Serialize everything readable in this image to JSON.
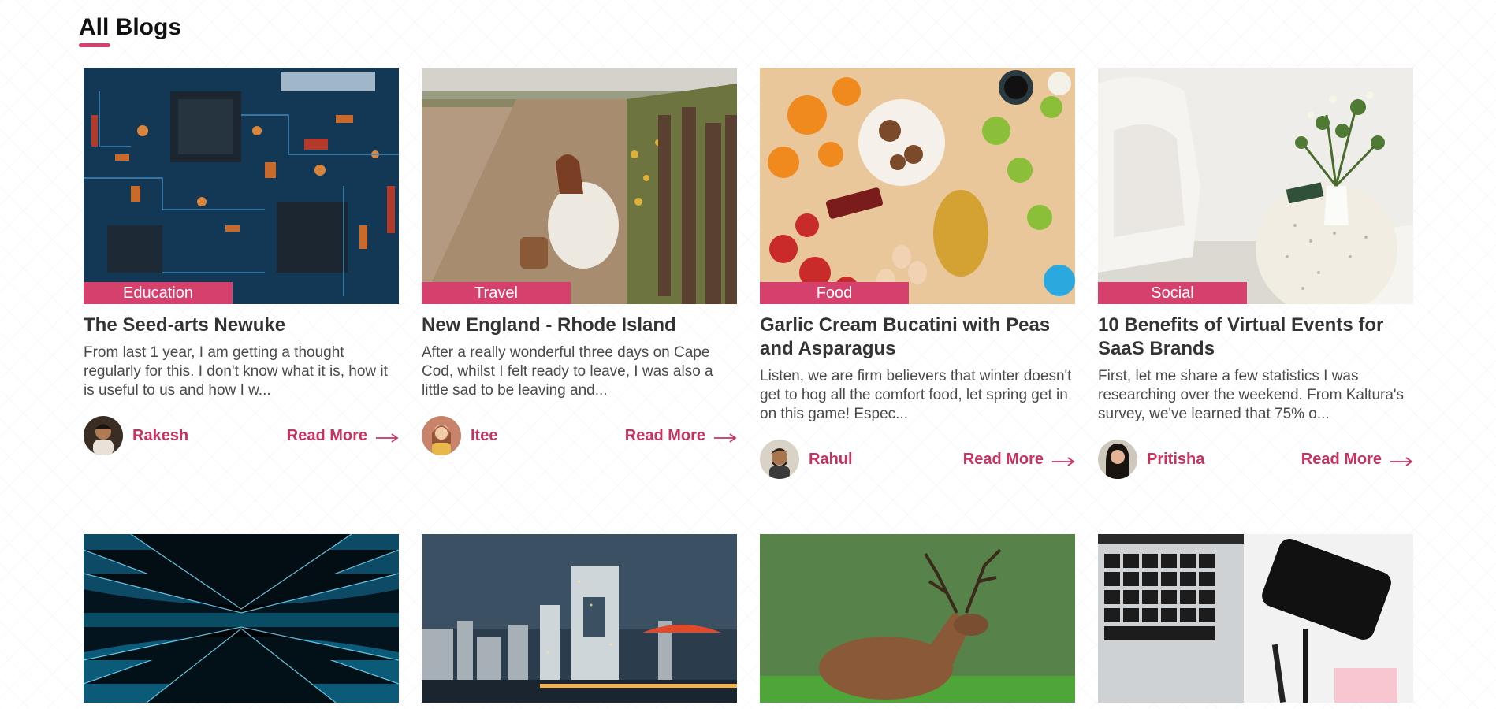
{
  "section": {
    "title": "All Blogs"
  },
  "colors": {
    "accent": "#d6406d",
    "link": "#c8325e"
  },
  "posts": [
    {
      "category": "Education",
      "title": "The Seed-arts Newuke",
      "excerpt": "From last 1 year, I am getting a thought regularly for this. I don't know what it is, how it is useful to us and how I w...",
      "author": "Rakesh",
      "read_more": "Read More"
    },
    {
      "category": "Travel",
      "title": "New England - Rhode Island",
      "excerpt": "After a really wonderful three days on Cape Cod, whilst I felt ready to leave, I was also a little sad to be leaving and...",
      "author": "Itee",
      "read_more": "Read More"
    },
    {
      "category": "Food",
      "title": "Garlic Cream Bucatini with Peas and Asparagus",
      "excerpt": "Listen, we are firm believers that winter doesn't get to hog all the comfort food, let spring get in on this game! Espec...",
      "author": "Rahul",
      "read_more": "Read More"
    },
    {
      "category": "Social",
      "title": "10 Benefits of Virtual Events for SaaS Brands",
      "excerpt": "First, let me share a few statistics I was researching over the weekend. From Kaltura's survey, we've learned that 75% o...",
      "author": "Pritisha",
      "read_more": "Read More"
    }
  ]
}
